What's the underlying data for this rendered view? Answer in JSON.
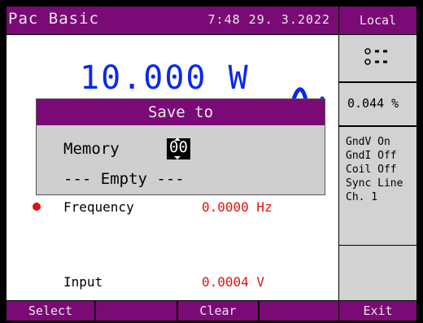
{
  "titlebar": {
    "title": "Pac Basic",
    "datetime": "7:48  29. 3.2022"
  },
  "local": {
    "label": "Local"
  },
  "reading": {
    "value": "10.000 W",
    "waveform_icon": "sine-wave-icon"
  },
  "params": [
    {
      "label": "Frequency",
      "value": "0.0000 Hz",
      "partially_hidden": true
    },
    {
      "label": "Input",
      "value": "0.0004  V"
    }
  ],
  "right_panel": {
    "indicator_icon": "terminal-dots-icon",
    "percent": "0.044 %",
    "status_lines": [
      "GndV On",
      "GndI Off",
      "Coil Off",
      "Sync Line",
      "Ch. 1"
    ]
  },
  "dialog": {
    "title": "Save to",
    "memory_label": "Memory",
    "memory_value": "00",
    "status": "--- Empty ---"
  },
  "softkeys": [
    "Select",
    "",
    "Clear",
    "",
    "Exit"
  ],
  "colors": {
    "bar": "#7a0a75",
    "reading": "#0a28f0",
    "value": "#e01010",
    "panel": "#d2d2d2",
    "dialog": "#cfcfcf"
  }
}
